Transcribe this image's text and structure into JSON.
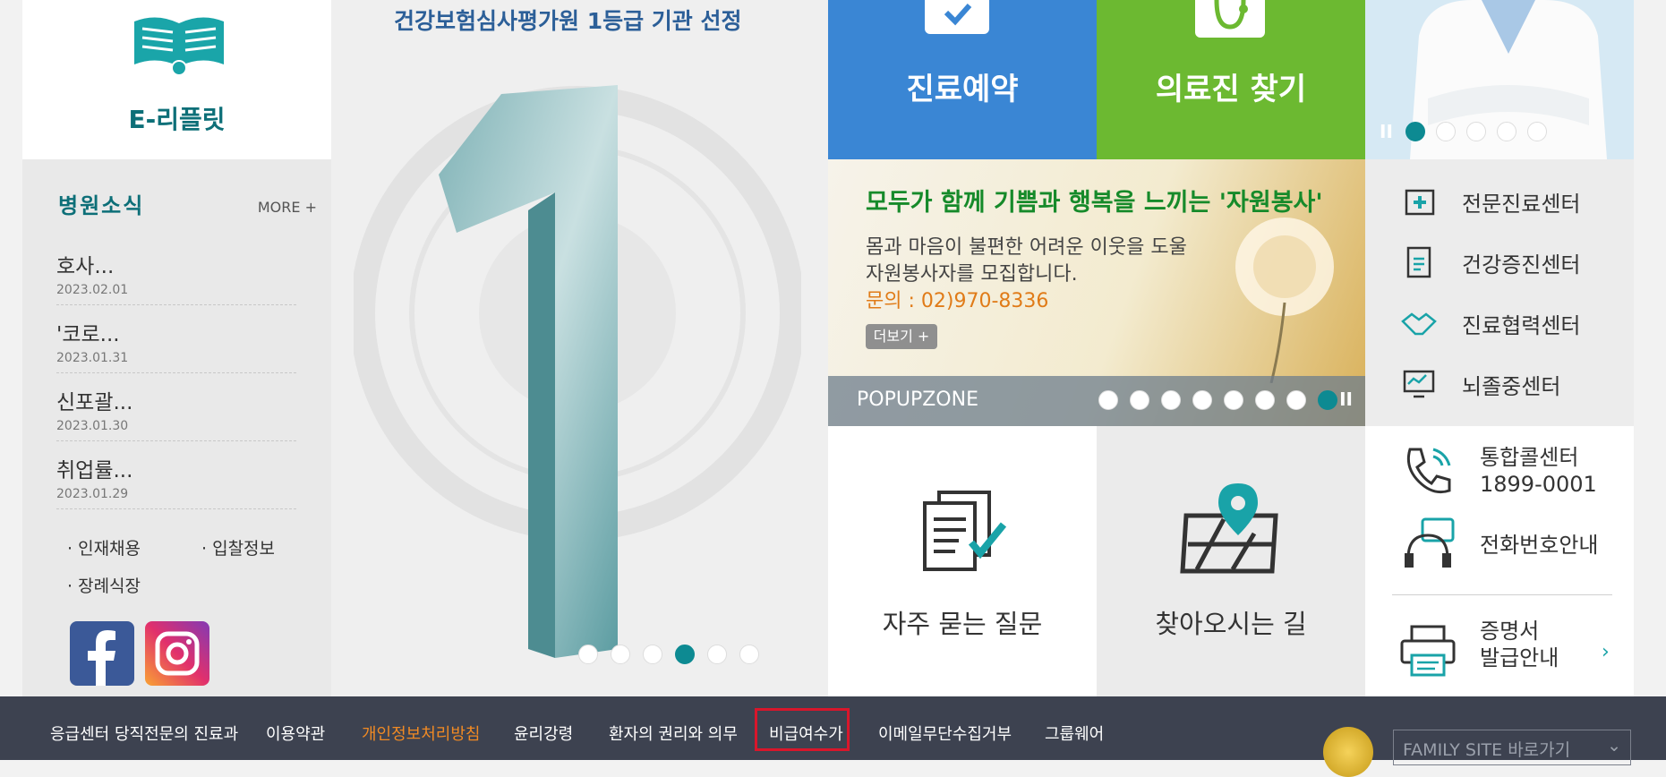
{
  "left": {
    "ebrochure_label": "E-리플릿",
    "news_title": "병원소식",
    "more": "MORE +",
    "news": [
      {
        "title": "호사...",
        "date": "2023.02.01"
      },
      {
        "title": "'코로...",
        "date": "2023.01.31"
      },
      {
        "title": "신포괄...",
        "date": "2023.01.30"
      },
      {
        "title": "취업률...",
        "date": "2023.01.29"
      }
    ],
    "links": [
      "인재채용",
      "입찰정보",
      "장례식장"
    ]
  },
  "hero": {
    "headline": "건강보험심사평가원 1등급 기관 선정",
    "big_number": "1",
    "slide_count": 6,
    "active_slide": 4
  },
  "tiles": {
    "reserve": "진료예약",
    "find_doctor": "의료진 찾기"
  },
  "doctor_slider": {
    "count": 5,
    "active": 1
  },
  "popup": {
    "headline": "모두가 함께 기쁨과 행복을 느끼는 '자원봉사'",
    "line1": "몸과 마음이 불편한 어려운 이웃을 도울",
    "line2": "자원봉사자를 모집합니다.",
    "contact": "문의 : 02)970-8336",
    "more_button": "더보기 +",
    "zone_label": "POPUPZONE",
    "dot_count": 8,
    "active_dot": 8
  },
  "centers": [
    "전문진료센터",
    "건강증진센터",
    "진료협력센터",
    "뇌졸중센터"
  ],
  "faq_label": "자주 묻는 질문",
  "directions_label": "찾아오시는 길",
  "contacts": {
    "callcenter_title": "통합콜센터",
    "callcenter_number": "1899-0001",
    "phone_guide": "전화번호안내",
    "cert_line1": "증명서",
    "cert_line2": "발급안내"
  },
  "footer": {
    "links": [
      "응급센터 당직전문의 진료과",
      "이용약관",
      "개인정보처리방침",
      "윤리강령",
      "환자의 권리와 의무",
      "비급여수가",
      "이메일무단수집거부",
      "그룹웨어"
    ],
    "family_site": "FAMILY SITE 바로가기"
  },
  "colors": {
    "privacy_link": "#f08a24",
    "teal": "#0d8a92",
    "highlight": "#d9162b"
  }
}
